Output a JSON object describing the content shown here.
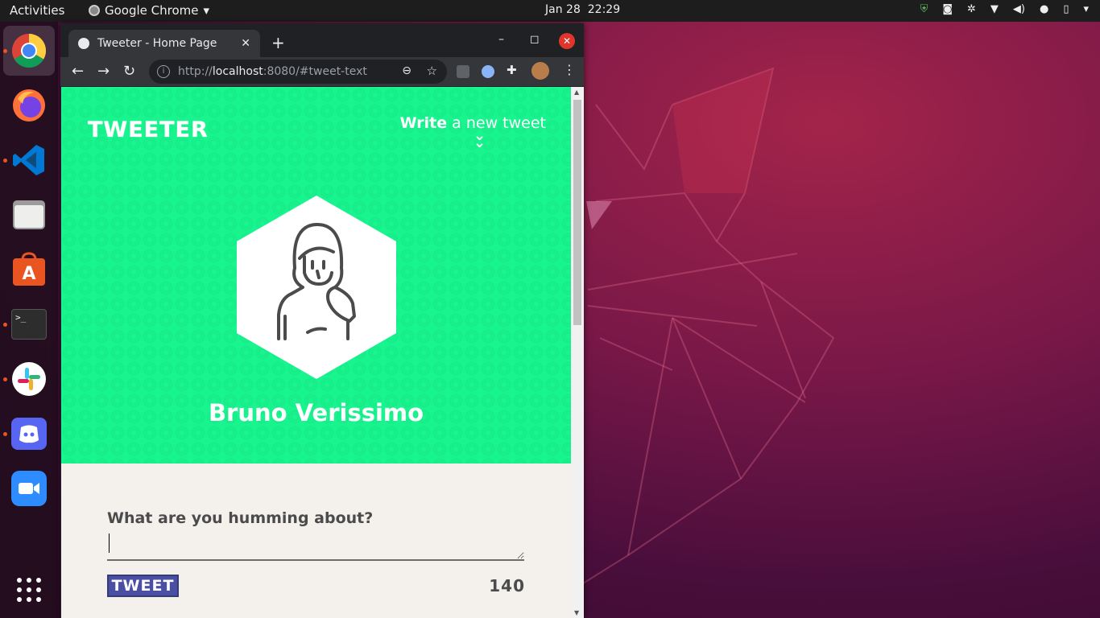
{
  "topbar": {
    "activities": "Activities",
    "app_name": "Google Chrome",
    "date": "Jan 28",
    "time": "22:29"
  },
  "dock": {
    "items": [
      {
        "name": "chrome",
        "icon": "chrome-icon",
        "running": true
      },
      {
        "name": "firefox",
        "icon": "firefox-icon",
        "running": false
      },
      {
        "name": "vscode",
        "icon": "vscode-icon",
        "running": true
      },
      {
        "name": "files",
        "icon": "files-icon",
        "running": false
      },
      {
        "name": "software",
        "icon": "software-store-icon",
        "running": false
      },
      {
        "name": "terminal",
        "icon": "terminal-icon",
        "running": true
      },
      {
        "name": "slack",
        "icon": "slack-icon",
        "running": true
      },
      {
        "name": "discord",
        "icon": "discord-icon",
        "running": true
      },
      {
        "name": "zoom",
        "icon": "zoom-icon",
        "running": false
      }
    ],
    "terminal_prompt": ">_"
  },
  "browser": {
    "tab_title": "Tweeter - Home Page",
    "url_prefix": "http://",
    "url_host": "localhost",
    "url_rest": ":8080/#tweet-text"
  },
  "page": {
    "logo": "TWEETER",
    "compose_bold": "Write",
    "compose_light": " a new tweet",
    "user_name": "Bruno Verissimo",
    "composer_label": "What are you humming about?",
    "tweet_button": "TWEET",
    "char_counter": "140",
    "colors": {
      "hero": "#18f48e",
      "body": "#f4f1ec",
      "button": "#4b4fa3",
      "text": "#4b4b4b"
    }
  }
}
